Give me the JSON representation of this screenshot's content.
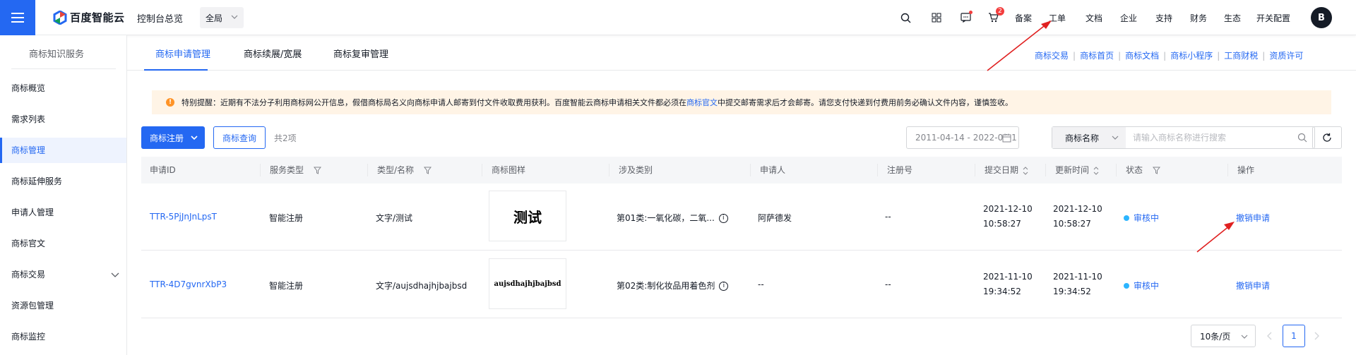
{
  "header": {
    "brand_name": "百度智能云",
    "console_link": "控制台总览",
    "region": "全局",
    "nav_items": [
      "备案",
      "工单",
      "文档",
      "企业",
      "支持",
      "财务",
      "生态",
      "开关配置"
    ],
    "cart_badge": "2",
    "avatar_letter": "B"
  },
  "sidebar": {
    "title": "商标知识服务",
    "items": [
      {
        "label": "商标概览"
      },
      {
        "label": "需求列表"
      },
      {
        "label": "商标管理",
        "active": true
      },
      {
        "label": "商标延伸服务"
      },
      {
        "label": "申请人管理"
      },
      {
        "label": "商标官文"
      },
      {
        "label": "商标交易",
        "expandable": true
      },
      {
        "label": "资源包管理"
      },
      {
        "label": "商标监控"
      }
    ]
  },
  "tabs": [
    "商标申请管理",
    "商标续展/宽展",
    "商标复审管理"
  ],
  "quick_links": [
    "商标交易",
    "商标首页",
    "商标文档",
    "商标小程序",
    "工商财税",
    "资质许可"
  ],
  "notice": {
    "text_before": "特别提醒：近期有不法分子利用商标网公开信息，假借商标局名义向商标申请人邮寄到付文件收取费用获利。百度智能云商标申请相关文件都必须在",
    "link_text": "商标官文",
    "text_after": "中提交邮寄需求后才会邮寄。请您支付快递到付费用前务必确认文件内容，谨慎签收。"
  },
  "toolbar": {
    "register_button": "商标注册",
    "query_button": "商标查询",
    "count_text": "共2项",
    "date_range": "2011-04-14 - 2022-04-1",
    "search_field": "商标名称",
    "search_placeholder": "请输入商标名称进行搜索"
  },
  "table": {
    "columns": [
      "申请ID",
      "服务类型",
      "类型/名称",
      "商标图样",
      "涉及类别",
      "申请人",
      "注册号",
      "提交日期",
      "更新时间",
      "状态",
      "操作"
    ],
    "rows": [
      {
        "id": "TTR-5PjJnJnLpsT",
        "service": "智能注册",
        "type_name": "文字/测试",
        "mark_text": "测试",
        "category": "第01类:一氧化碳，二氧...",
        "applicant": "阿萨德发",
        "reg_no": "--",
        "submit_date": "2021-12-10",
        "submit_time": "10:58:27",
        "update_date": "2021-12-10",
        "update_time": "10:58:27",
        "status": "审核中",
        "action": "撤销申请"
      },
      {
        "id": "TTR-4D7gvnrXbP3",
        "service": "智能注册",
        "type_name": "文字/aujsdhajhjbajbsd",
        "mark_text": "aujsdhajhjbajbsd",
        "category": "第02类:制化妆品用着色剂",
        "applicant": "--",
        "reg_no": "--",
        "submit_date": "2021-11-10",
        "submit_time": "19:34:52",
        "update_date": "2021-11-10",
        "update_time": "19:34:52",
        "status": "审核中",
        "action": "撤销申请"
      }
    ]
  },
  "pagination": {
    "page_size": "10条/页",
    "current_page": "1"
  },
  "colors": {
    "primary": "#2468f2",
    "notice_bg": "#fff4e6",
    "status_dot": "#2cb5ff",
    "annotation_arrow": "#e02020"
  }
}
